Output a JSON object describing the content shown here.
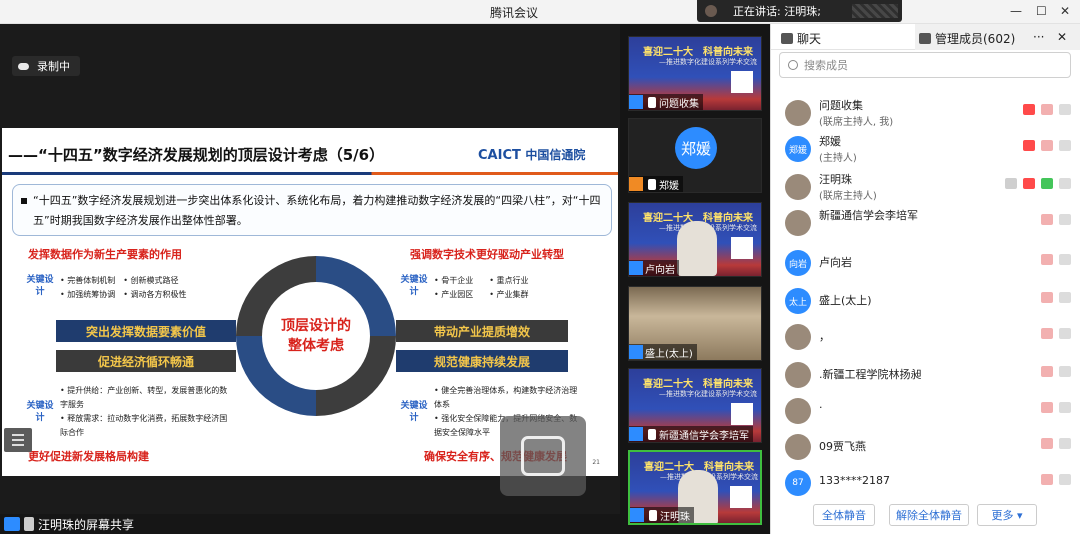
{
  "window": {
    "title": "腾讯会议",
    "minimize": "—",
    "maximize": "☐",
    "close": "✕"
  },
  "speaking": {
    "label": "正在讲话: 汪明珠;"
  },
  "recording": {
    "label": "录制中"
  },
  "slide": {
    "heading": "——“十四五”数字经济发展规划的顶层设计考虑（5/6）",
    "logo_en": "CAICT",
    "logo_cn": "中国信通院",
    "intro": "“十四五”数字经济发展规划进一步突出体系化设计、系统化布局，着力构建推动数字经济发展的“四梁八柱”，对“十四五”时期我国数字经济发展作出整体性部署。",
    "sec_tl": "发挥数据作为新生产要素的作用",
    "sec_tr": "强调数字技术更好驱动产业转型",
    "sec_bl": "更好促进新发展格局构建",
    "sec_br": "确保安全有序、规范健康发展",
    "keyword": "关键设计",
    "tl_points": "• 完善体制机制　• 创新模式路径\n• 加强统筹协调　• 调动各方积极性",
    "tr_points": "• 骨干企业　　• 重点行业\n• 产业园区　　• 产业集群",
    "bl_points": "• 提升供给：产业创新、转型，发展普惠化的数字服务\n• 释放需求：拉动数字化消费，拓展数字经济国际合作",
    "br_points": "• 健全完善治理体系，构建数字经济治理体系\n• 强化安全保障能力，提升网络安全、数据安全保障水平",
    "bar_l1": "突出发挥数据要素价值",
    "bar_l2": "促进经济循环畅通",
    "bar_r1": "带动产业提质增效",
    "bar_r2": "规范健康持续发展",
    "center": "顶层设计的\n整体考虑",
    "page": "21"
  },
  "sharer": {
    "label": "汪明珠的屏幕共享"
  },
  "tiles": [
    {
      "name": "问题收集",
      "poster_t1": "喜迎二十大　科普向未来",
      "poster_t2": "—推进数字化建设系列学术交流"
    },
    {
      "name": "郑媛",
      "avatar": "郑媛"
    },
    {
      "name": "卢向岩",
      "poster_t1": "喜迎二十大　科普向未来",
      "poster_t2": "—推进数字化建设系列学术交流"
    },
    {
      "name": "盛上(太上)"
    },
    {
      "name": "新疆通信学会李培军",
      "poster_t1": "喜迎二十大　科普向未来",
      "poster_t2": "—推进数字化建设系列学术交流"
    },
    {
      "name": "汪明珠",
      "poster_t1": "喜迎二十大　科普向未来",
      "poster_t2": "—推进数字化建设系列学术交流"
    }
  ],
  "panel": {
    "tab_chat": "聊天",
    "tab_members": "管理成员(602)",
    "more": "···",
    "close": "✕",
    "search_placeholder": "搜索成员",
    "members": [
      {
        "name": "问题收集",
        "sub": "(联席主持人, 我)"
      },
      {
        "name": "郑媛",
        "sub": "(主持人)",
        "avatar": "郑媛"
      },
      {
        "name": "汪明珠",
        "sub": "(联席主持人)"
      },
      {
        "name": "新疆通信学会李培军",
        "sub": ""
      },
      {
        "name": "卢向岩",
        "sub": "",
        "avatar": "向岩"
      },
      {
        "name": "盛上(太上)",
        "sub": "",
        "avatar": "太上"
      },
      {
        "name": "，",
        "sub": ""
      },
      {
        "name": ".新疆工程学院林扬昶",
        "sub": ""
      },
      {
        "name": ".",
        "sub": ""
      },
      {
        "name": "09贾飞燕",
        "sub": ""
      },
      {
        "name": "133****2187",
        "sub": "",
        "avatar": "87"
      }
    ],
    "btn_mute_all": "全体静音",
    "btn_unmute_all": "解除全体静音",
    "btn_more": "更多 ▾"
  }
}
